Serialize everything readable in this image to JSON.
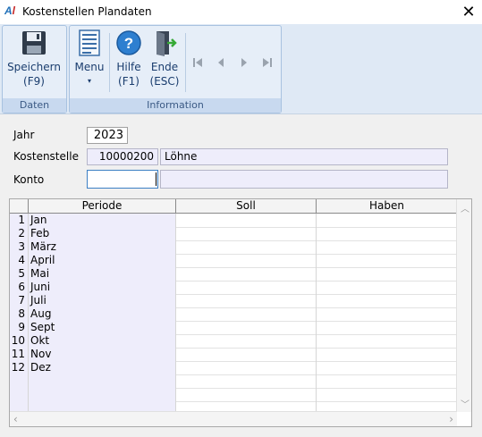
{
  "window": {
    "logo": "A",
    "logo_accent": "l",
    "title": "Kostenstellen Plandaten",
    "close_glyph": "✕"
  },
  "ribbon": {
    "groups": [
      {
        "label": "Daten"
      },
      {
        "label": "Information"
      }
    ],
    "buttons": {
      "save": {
        "line1": "Speichern",
        "line2": "(F9)"
      },
      "menu": {
        "line1": "Menu",
        "line2": "▾"
      },
      "help": {
        "line1": "Hilfe",
        "line2": "(F1)"
      },
      "exit": {
        "line1": "Ende",
        "line2": "(ESC)"
      }
    }
  },
  "form": {
    "jahr_label": "Jahr",
    "jahr_value": "2023",
    "kostenstelle_label": "Kostenstelle",
    "kostenstelle_value": "10000200",
    "kostenstelle_name": "Löhne",
    "konto_label": "Konto",
    "konto_value": "",
    "konto_name": ""
  },
  "grid": {
    "columns": {
      "periode": "Periode",
      "soll": "Soll",
      "haben": "Haben"
    },
    "rows": [
      {
        "num": "1",
        "periode": "Jan",
        "soll": "",
        "haben": ""
      },
      {
        "num": "2",
        "periode": "Feb",
        "soll": "",
        "haben": ""
      },
      {
        "num": "3",
        "periode": "März",
        "soll": "",
        "haben": ""
      },
      {
        "num": "4",
        "periode": "April",
        "soll": "",
        "haben": ""
      },
      {
        "num": "5",
        "periode": "Mai",
        "soll": "",
        "haben": ""
      },
      {
        "num": "6",
        "periode": "Juni",
        "soll": "",
        "haben": ""
      },
      {
        "num": "7",
        "periode": "Juli",
        "soll": "",
        "haben": ""
      },
      {
        "num": "8",
        "periode": "Aug",
        "soll": "",
        "haben": ""
      },
      {
        "num": "9",
        "periode": "Sept",
        "soll": "",
        "haben": ""
      },
      {
        "num": "10",
        "periode": "Okt",
        "soll": "",
        "haben": ""
      },
      {
        "num": "11",
        "periode": "Nov",
        "soll": "",
        "haben": ""
      },
      {
        "num": "12",
        "periode": "Dez",
        "soll": "",
        "haben": ""
      },
      {
        "num": "",
        "periode": "",
        "soll": "",
        "haben": ""
      },
      {
        "num": "",
        "periode": "",
        "soll": "",
        "haben": ""
      },
      {
        "num": "",
        "periode": "",
        "soll": "",
        "haben": ""
      }
    ]
  }
}
